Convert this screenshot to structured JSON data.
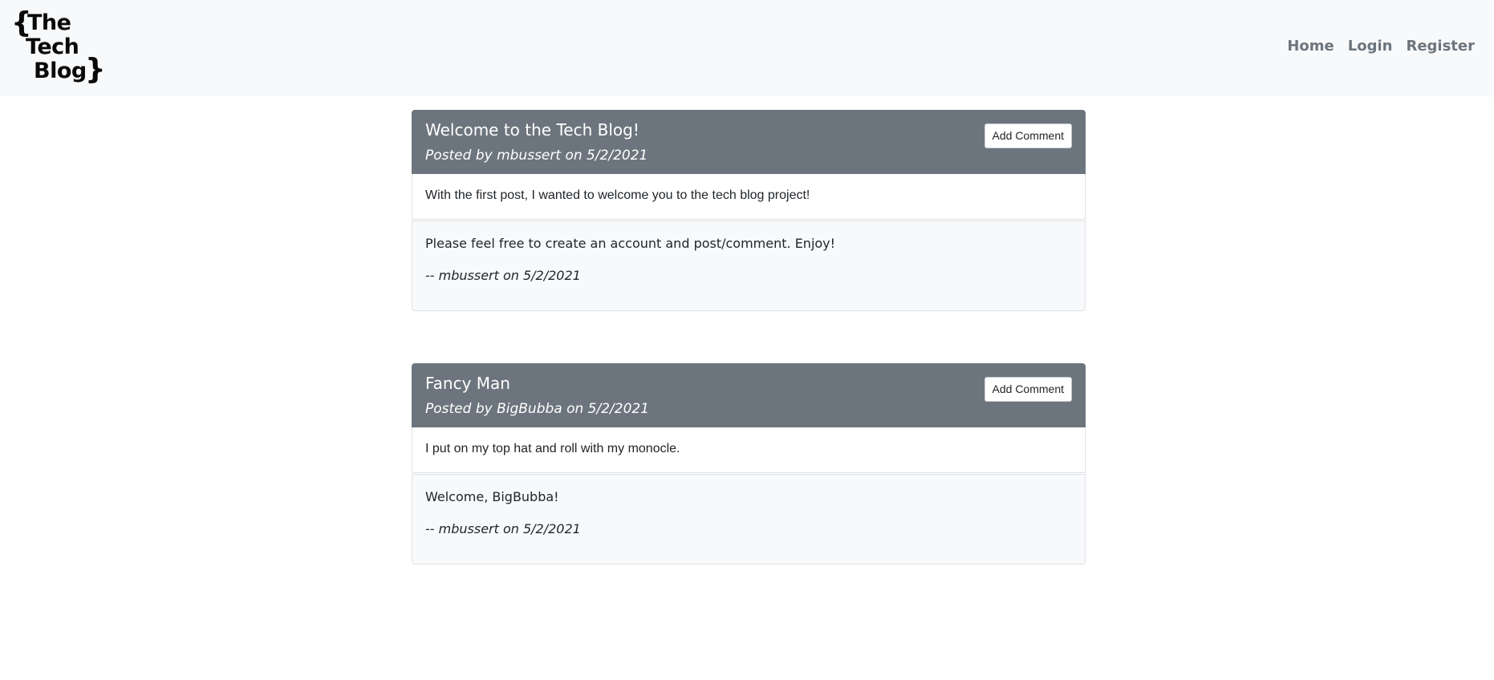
{
  "nav": {
    "logo_words": [
      "The",
      "Tech",
      "Blog"
    ],
    "logo_brace_open": "{",
    "logo_brace_close": "}",
    "links": [
      "Home",
      "Login",
      "Register"
    ]
  },
  "posts": [
    {
      "title": "Welcome to the Tech Blog!",
      "meta": "Posted by mbussert on 5/2/2021",
      "button_label": "Add Comment",
      "body": "With the first post, I wanted to welcome you to the tech blog project!",
      "comment": {
        "text": "Please feel free to create an account and post/comment. Enjoy!",
        "author": "-- mbussert on 5/2/2021"
      }
    },
    {
      "title": "Fancy Man",
      "meta": "Posted by BigBubba on 5/2/2021",
      "button_label": "Add Comment",
      "body": "I put on my top hat and roll with my monocle.",
      "comment": {
        "text": "Welcome, BigBubba!",
        "author": "-- mbussert on 5/2/2021"
      }
    }
  ],
  "colors": {
    "navbar_bg": "#f8f9fa",
    "header_bg": "#6c757d",
    "nav_link": "#6c757d",
    "comment_bg": "#f8f9fa"
  }
}
